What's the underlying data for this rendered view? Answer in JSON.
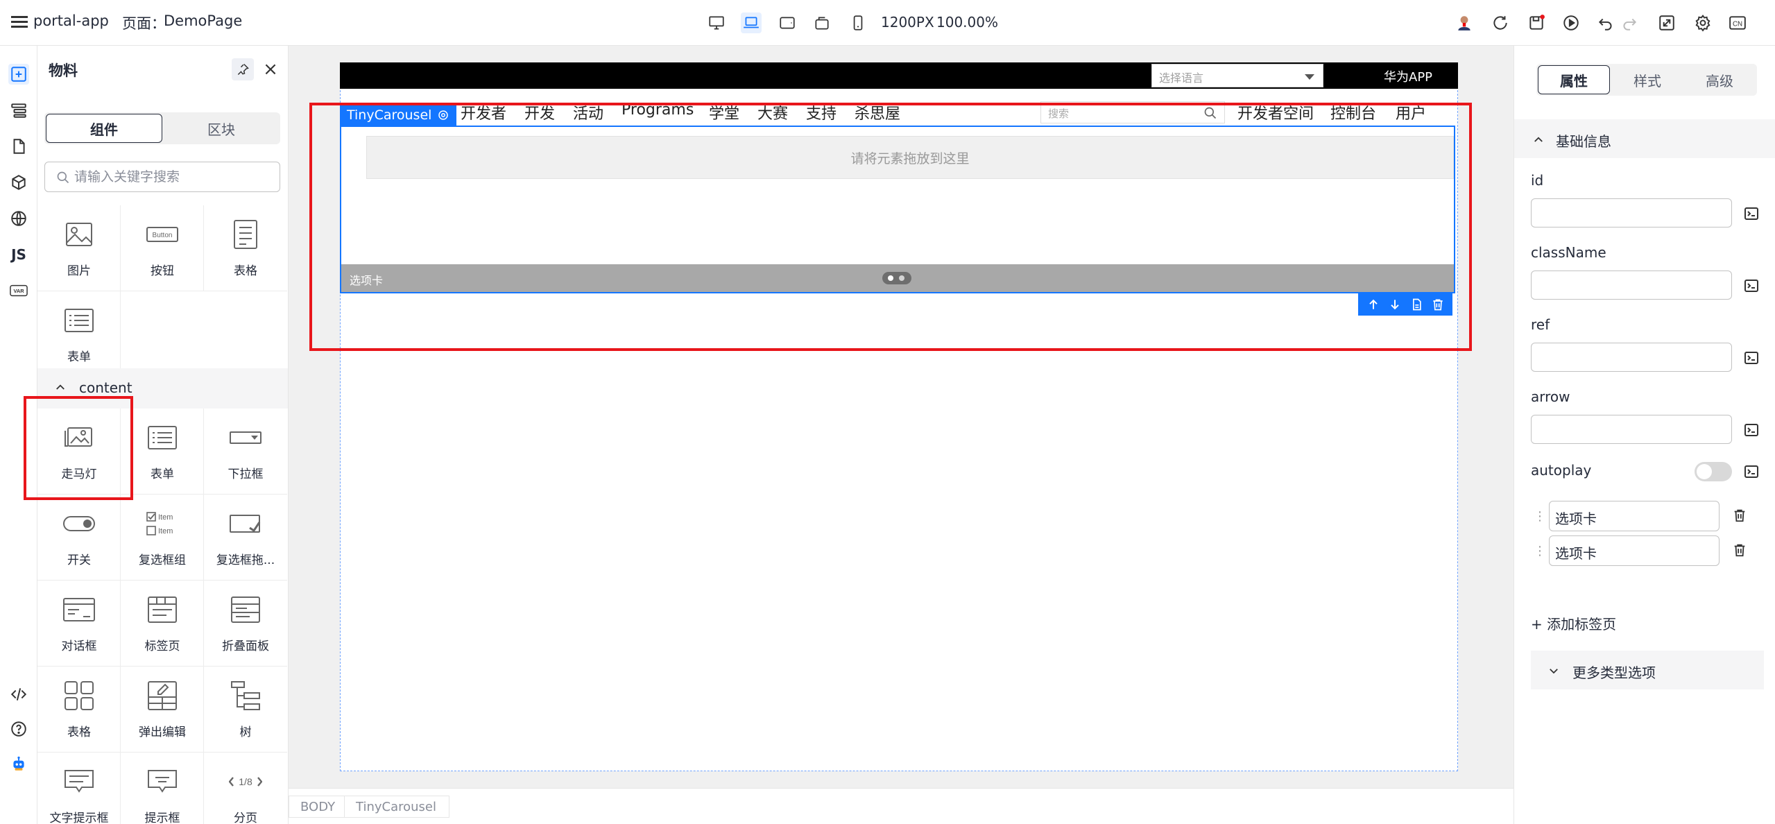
{
  "topbar": {
    "app_name": "portal-app",
    "page_label": "页面：",
    "page_name": "DemoPage",
    "canvas_width": "1200PX",
    "zoom": "100.00%",
    "lang": "CN"
  },
  "material": {
    "title": "物料",
    "tabs": [
      "组件",
      "区块"
    ],
    "search_placeholder": "请输入关键字搜索",
    "group_a": [
      "图片",
      "按钮",
      "表格",
      "表单"
    ],
    "group_content_title": "content",
    "group_content": [
      "走马灯",
      "表单",
      "下拉框",
      "开关",
      "复选框组",
      "复选框拖...",
      "对话框",
      "标签页",
      "折叠面板",
      "表格",
      "弹出编辑",
      "树",
      "文字提示框",
      "提示框",
      "分页"
    ],
    "button_icon_text": "Button",
    "checkbox_icon_text": "Item",
    "pager_icon_text": "1/8"
  },
  "canvas": {
    "lang_placeholder": "选择语言",
    "brand_link": "华为APP",
    "nav": [
      "开发者",
      "开发",
      "活动",
      "Programs",
      "学堂",
      "大赛",
      "支持",
      "杀思屋"
    ],
    "nav_search_placeholder": "搜索",
    "nav_right": [
      "开发者空间",
      "控制台",
      "用户"
    ],
    "carousel_tag": "TinyCarousel",
    "dropzone_text": "请将元素拖放到这里",
    "carousel_tab_label": "选项卡"
  },
  "breadcrumb": [
    "BODY",
    "TinyCarousel"
  ],
  "props": {
    "tabs": [
      "属性",
      "样式",
      "高级"
    ],
    "section_title": "基础信息",
    "fields": [
      "id",
      "className",
      "ref",
      "arrow"
    ],
    "autoplay_label": "autoplay",
    "autoplay_on": false,
    "tab_items": [
      "选项卡",
      "选项卡"
    ],
    "add_tab": "+ 添加标签页",
    "more_options": "更多类型选项"
  },
  "colors": {
    "accent": "#1476ff",
    "highlight": "#e8161b"
  }
}
